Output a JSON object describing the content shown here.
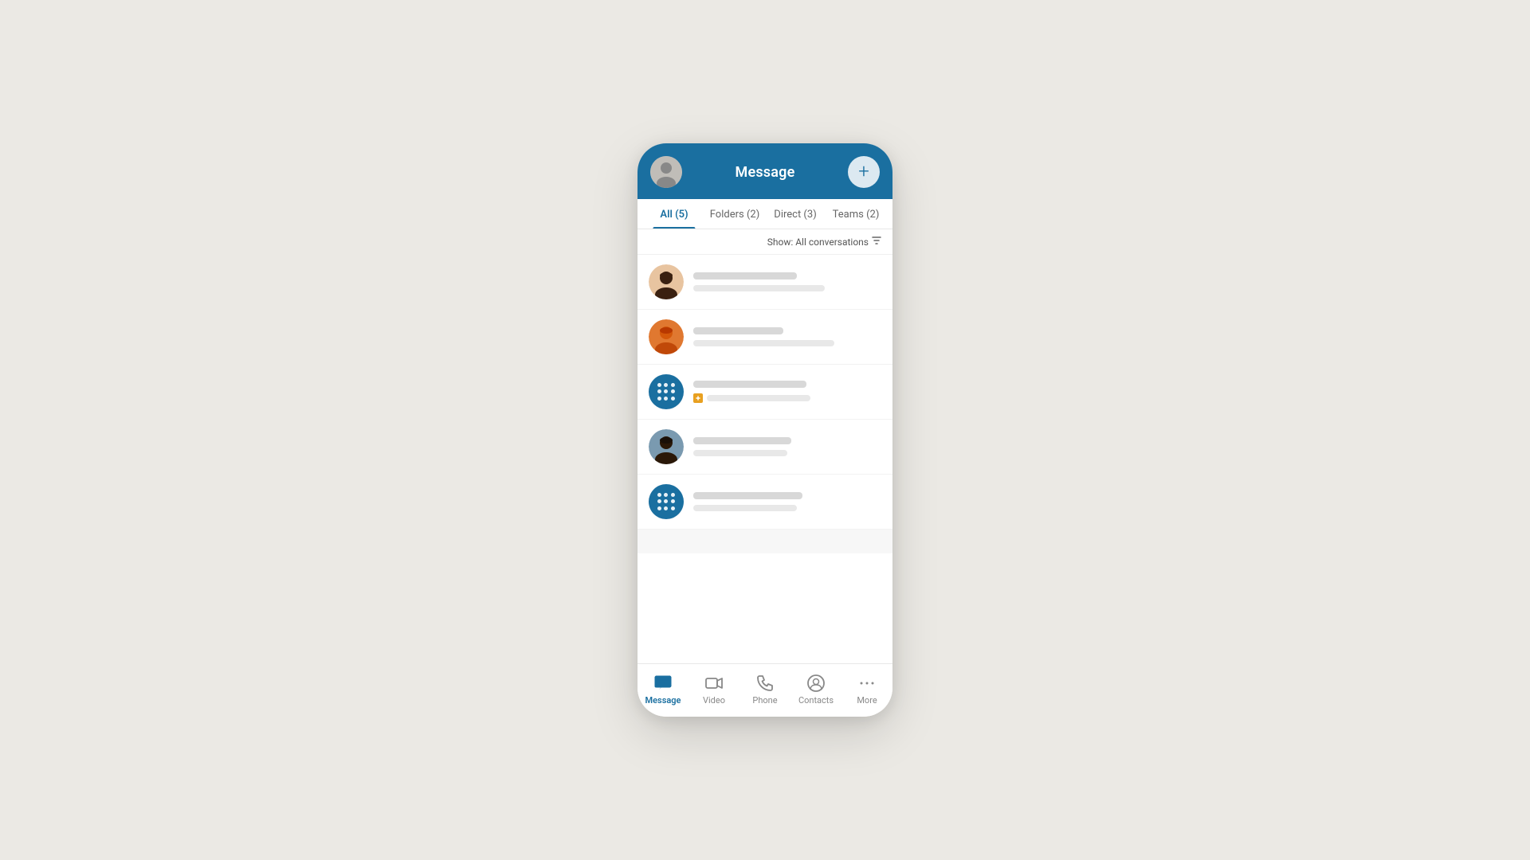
{
  "app": {
    "title": "Message",
    "background_color": "#ebe9e4",
    "accent_color": "#1a6fa0"
  },
  "header": {
    "title": "Message",
    "add_button_label": "+"
  },
  "tabs": [
    {
      "id": "all",
      "label": "All (5)",
      "active": true
    },
    {
      "id": "folders",
      "label": "Folders (2)",
      "active": false
    },
    {
      "id": "direct",
      "label": "Direct (3)",
      "active": false
    },
    {
      "id": "teams",
      "label": "Teams (2)",
      "active": false
    }
  ],
  "filter": {
    "label": "Show: All conversations"
  },
  "conversations": [
    {
      "id": 1,
      "type": "photo",
      "style": "woman1",
      "name_bar_width": "55%",
      "msg_bar_width": "70%",
      "has_attachment": false
    },
    {
      "id": 2,
      "type": "photo",
      "style": "woman2",
      "name_bar_width": "48%",
      "msg_bar_width": "75%",
      "has_attachment": false
    },
    {
      "id": 3,
      "type": "team",
      "name_bar_width": "60%",
      "msg_bar_width": "65%",
      "has_attachment": true
    },
    {
      "id": 4,
      "type": "photo",
      "style": "man1",
      "name_bar_width": "52%",
      "msg_bar_width": "50%",
      "has_attachment": false
    },
    {
      "id": 5,
      "type": "team",
      "name_bar_width": "58%",
      "msg_bar_width": "55%",
      "has_attachment": false
    }
  ],
  "bottom_nav": [
    {
      "id": "message",
      "label": "Message",
      "active": true,
      "icon": "message-icon"
    },
    {
      "id": "video",
      "label": "Video",
      "active": false,
      "icon": "video-icon"
    },
    {
      "id": "phone",
      "label": "Phone",
      "active": false,
      "icon": "phone-icon"
    },
    {
      "id": "contacts",
      "label": "Contacts",
      "active": false,
      "icon": "contacts-icon"
    },
    {
      "id": "more",
      "label": "More",
      "active": false,
      "icon": "more-icon"
    }
  ]
}
